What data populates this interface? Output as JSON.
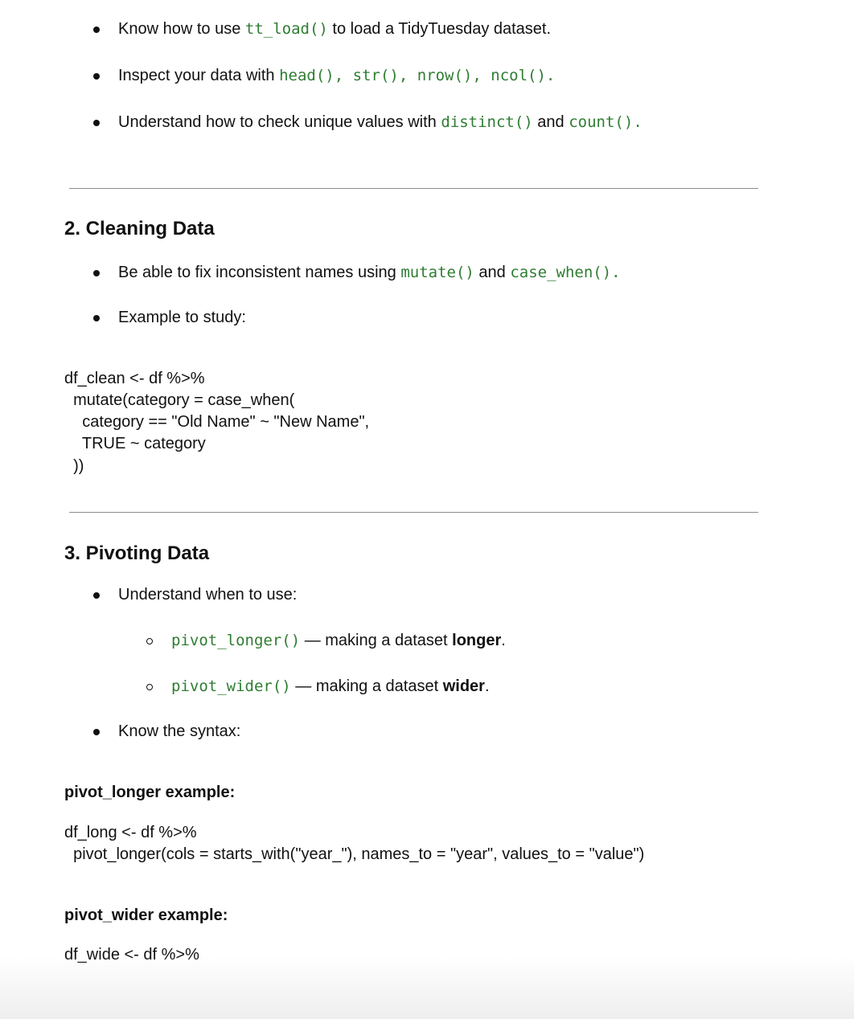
{
  "list1": [
    {
      "pre": "Know how to use ",
      "c1": "tt_load()",
      "post": " to load a TidyTuesday dataset."
    },
    {
      "pre": "Inspect your data with ",
      "c1": "head()",
      "s1": ", ",
      "c2": "str()",
      "s2": ", ",
      "c3": "nrow()",
      "s3": ", ",
      "c4": "ncol()",
      "post": "."
    },
    {
      "pre": "Understand how to check unique values with ",
      "c1": "distinct()",
      "mid": " and ",
      "c2": "count()",
      "post": "."
    }
  ],
  "section2": {
    "heading": "2. Cleaning Data",
    "item1": {
      "pre": "Be able to fix inconsistent names using ",
      "c1": "mutate()",
      "mid": " and ",
      "c2": "case_when()",
      "post": "."
    },
    "item2": "Example to study:",
    "code": [
      "df_clean <- df %>%",
      "  mutate(category = case_when(",
      "    category == \"Old Name\" ~ \"New Name\",",
      "    TRUE ~ category",
      "  ))"
    ]
  },
  "section3": {
    "heading": "3. Pivoting Data",
    "item1": "Understand when to use:",
    "sub": [
      {
        "code": "pivot_longer()",
        "pre": " — making a dataset ",
        "bold": "longer",
        "post": "."
      },
      {
        "code": "pivot_wider()",
        "pre": " — making a dataset ",
        "bold": "wider",
        "post": "."
      }
    ],
    "item2": "Know the syntax:",
    "longer_label": "pivot_longer example:",
    "longer_code": [
      "df_long <- df %>%",
      "  pivot_longer(cols = starts_with(\"year_\"), names_to = \"year\", values_to = \"value\")"
    ],
    "wider_label": "pivot_wider example:",
    "wider_code": [
      "df_wide <- df %>%"
    ]
  }
}
